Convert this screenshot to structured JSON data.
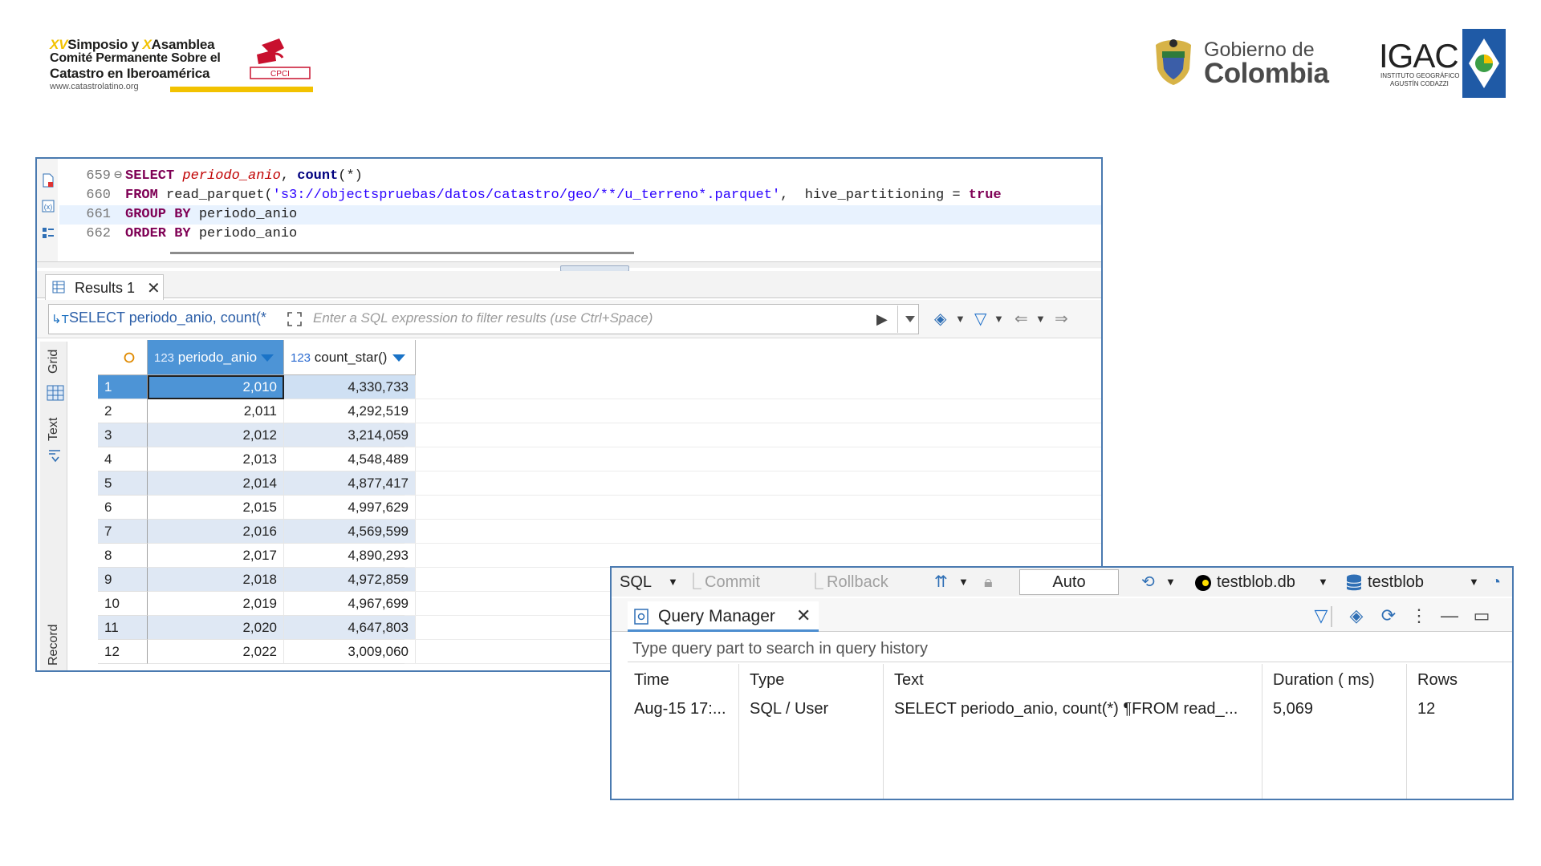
{
  "header": {
    "cpsc": {
      "line1_prefix": "XV",
      "line1_mid": "Simposio y ",
      "line1_accent": "X",
      "line1_suffix": "Asamblea",
      "line2": "Comité Permanente Sobre el",
      "line3": "Catastro en Iberoamérica",
      "url": "www.catastrolatino.org",
      "mark_text": "CPCI"
    },
    "gobierno": {
      "line1": "Gobierno de",
      "line2": "Colombia"
    },
    "igac": {
      "title": "IGAC",
      "sub1": "INSTITUTO GEOGRÁFICO",
      "sub2": "AGUSTÍN CODAZZI"
    }
  },
  "editor": {
    "lines": [
      {
        "num": "659",
        "fold": "⊖",
        "tokens": [
          [
            "kw",
            "SELECT "
          ],
          [
            "ital",
            "periodo_anio"
          ],
          [
            "plain",
            ", "
          ],
          [
            "kw2",
            "count"
          ],
          [
            "plain",
            "(*)"
          ]
        ]
      },
      {
        "num": "660",
        "fold": "",
        "tokens": [
          [
            "kw",
            "FROM "
          ],
          [
            "plain",
            "read_parquet("
          ],
          [
            "str",
            "'s3://objectspruebas/datos/catastro/geo/**/u_terreno*.parquet'"
          ],
          [
            "plain",
            ",  hive_partitioning = "
          ],
          [
            "kw",
            "true"
          ]
        ]
      },
      {
        "num": "661",
        "fold": "",
        "tokens": [
          [
            "kw",
            "GROUP BY "
          ],
          [
            "plain",
            "periodo_anio"
          ]
        ]
      },
      {
        "num": "662",
        "fold": "",
        "tokens": [
          [
            "kw",
            "ORDER BY "
          ],
          [
            "plain",
            "periodo_anio"
          ]
        ]
      }
    ]
  },
  "results": {
    "tab_label": "Results 1",
    "tab_close": "✕",
    "filter_query": "SELECT periodo_anio, count(*",
    "filter_placeholder": "Enter a SQL expression to filter results (use Ctrl+Space)",
    "side_tabs": {
      "grid": "Grid",
      "text": "Text",
      "record": "Record"
    },
    "columns": [
      {
        "type": "123",
        "name": "periodo_anio"
      },
      {
        "type": "123",
        "name": "count_star()"
      }
    ],
    "rows": [
      {
        "n": "1",
        "a": "2,010",
        "b": "4,330,733"
      },
      {
        "n": "2",
        "a": "2,011",
        "b": "4,292,519"
      },
      {
        "n": "3",
        "a": "2,012",
        "b": "3,214,059"
      },
      {
        "n": "4",
        "a": "2,013",
        "b": "4,548,489"
      },
      {
        "n": "5",
        "a": "2,014",
        "b": "4,877,417"
      },
      {
        "n": "6",
        "a": "2,015",
        "b": "4,997,629"
      },
      {
        "n": "7",
        "a": "2,016",
        "b": "4,569,599"
      },
      {
        "n": "8",
        "a": "2,017",
        "b": "4,890,293"
      },
      {
        "n": "9",
        "a": "2,018",
        "b": "4,972,859"
      },
      {
        "n": "10",
        "a": "2,019",
        "b": "4,967,699"
      },
      {
        "n": "11",
        "a": "2,020",
        "b": "4,647,803"
      },
      {
        "n": "12",
        "a": "2,022",
        "b": "3,009,060"
      }
    ]
  },
  "query_manager": {
    "toolbar": {
      "sql": "SQL",
      "commit": "Commit",
      "rollback": "Rollback",
      "auto": "Auto",
      "datasource": "testblob.db",
      "schema": "testblob"
    },
    "tab_label": "Query Manager",
    "tab_close": "✕",
    "search_placeholder": "Type query part to search in query history",
    "columns": [
      "Time",
      "Type",
      "Text",
      "Duration ( ms)",
      "Rows"
    ],
    "rows": [
      {
        "time": "Aug-15 17:...",
        "type": "SQL / User",
        "text": "SELECT periodo_anio, count(*) ¶FROM read_...",
        "duration": "5,069",
        "rows": "12"
      }
    ]
  },
  "colors": {
    "window_border": "#4a7ab0",
    "selection": "#4d94d6",
    "alt_row": "#dfe8f4",
    "cpsc_yellow": "#f2c200"
  }
}
